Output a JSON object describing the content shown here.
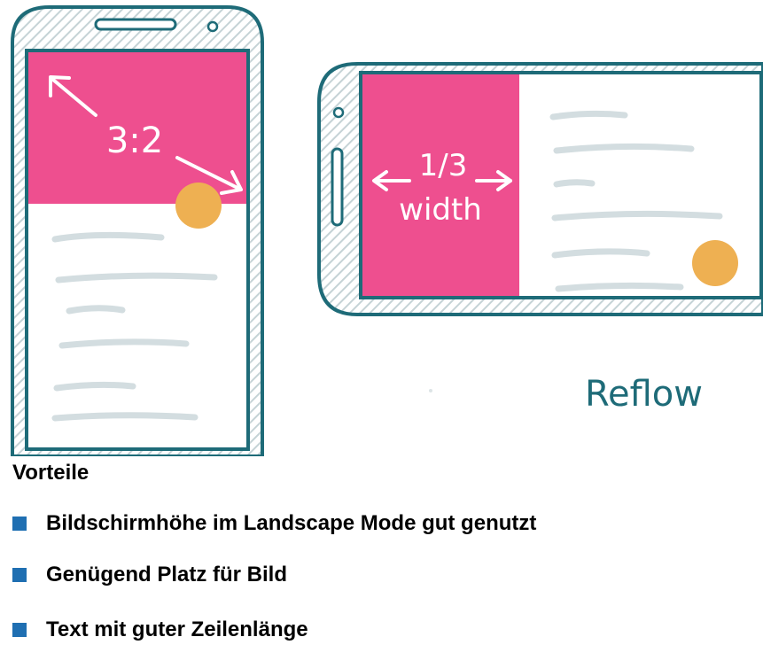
{
  "illustration": {
    "portrait_ratio_label": "3:2",
    "landscape_fraction_label": "1/3",
    "landscape_width_label": "width",
    "caption": "Reflow",
    "colors": {
      "frame": "#1e6b78",
      "hatch": "#c5d3d6",
      "image": "#ee4f8f",
      "accent_dot": "#eeb052",
      "text_lines": "#d3dde0"
    }
  },
  "content": {
    "heading": "Vorteile",
    "bullets": [
      "Bildschirmhöhe im Landscape Mode gut genutzt",
      "Genügend Platz für Bild",
      "Text mit guter Zeilenlänge"
    ],
    "bullet_color": "#1f6fb2"
  }
}
